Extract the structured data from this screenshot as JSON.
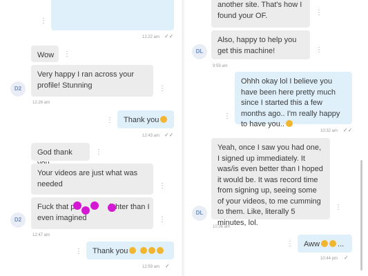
{
  "left": {
    "msg_time_1": "12:22 am",
    "wow": "Wow",
    "very_happy": "Very happy I ran across your profile! Stunning",
    "avatar_1": "D2",
    "msg_time_2": "12:26 am",
    "thank_you": "Thank you",
    "msg_time_3": "12:43 am",
    "god_thank_you": "God thank you",
    "videos": "Your videos are just what was needed",
    "fuck_that_prefix": "Fuck that p",
    "fuck_that_middle": "ighter than I",
    "fuck_that_suffix": "even imagined",
    "avatar_2": "D2",
    "msg_time_4": "12:47 am",
    "thank_you_2": "Thank you",
    "msg_time_5": "12:59 am"
  },
  "right": {
    "top_line": "another site. That's how I found your OF.",
    "happy_help": "Also, happy to help you get this machine!",
    "avatar_1": "DL",
    "msg_time_1": "9:59 am",
    "ohhh": "Ohhh okay lol I believe you have been here pretty much since I started this a few months ago.. I'm really happy to have you..",
    "msg_time_2": "10:32 am",
    "yeah": "Yeah, once I saw you had one, I signed up immediately. It was/is even better than I hoped it would be. It was record time from signing up, seeing some of your videos, to me cumming to them. Like, literally 5 minutes, lol.",
    "avatar_2": "DL",
    "msg_time_3": "10:36 am",
    "aww": "Aww",
    "msg_time_4": "10:44 pm"
  },
  "colors": {
    "incoming_bubble": "#ececec",
    "outgoing_bubble": "#dff0fb",
    "avatar_text": "#6f8fc0",
    "censor_dot": "#d418d4",
    "emoji": "#f2b530"
  }
}
